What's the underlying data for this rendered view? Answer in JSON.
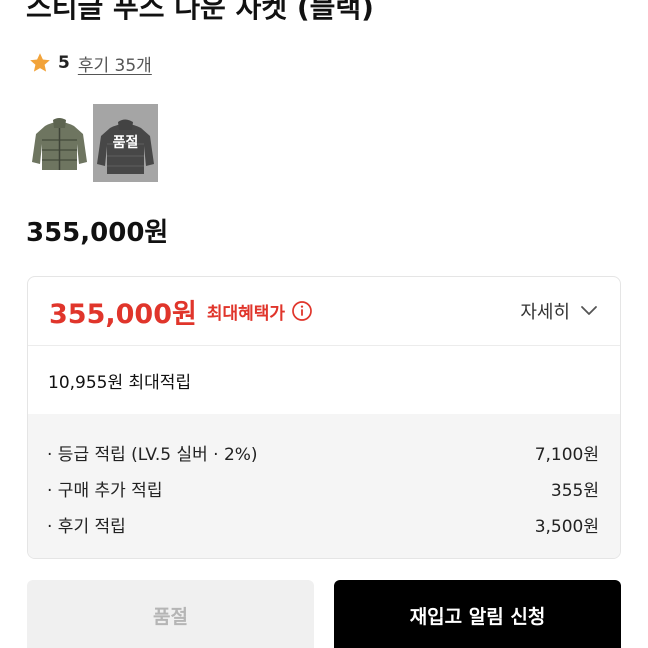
{
  "product": {
    "title": "스티글 푸스 다운 자켓 (블랙)",
    "rating_score": "5",
    "reviews_label": "후기 35개",
    "thumbnail_soldout_label": "품절",
    "price": "355,000원"
  },
  "benefit": {
    "max_price": "355,000원",
    "max_price_label": "최대혜택가",
    "detail_label": "자세히",
    "max_points": "10,955원 최대적립",
    "items": [
      {
        "label": "· 등급 적립 (LV.5 실버 · 2%)",
        "value": "7,100원"
      },
      {
        "label": "· 구매 추가 적립",
        "value": "355원"
      },
      {
        "label": "· 후기 적립",
        "value": "3,500원"
      }
    ]
  },
  "actions": {
    "soldout_label": "품절",
    "restock_label": "재입고 알림 신청"
  },
  "colors": {
    "accent_red": "#e0352b",
    "star": "#f2a33a"
  }
}
